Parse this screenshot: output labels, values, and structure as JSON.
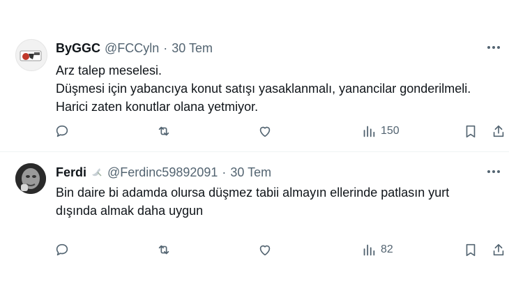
{
  "tweets": [
    {
      "author_name": "ByGGC",
      "handle": "@FCCyln",
      "separator": "·",
      "date": "30 Tem",
      "text": "Arz talep meselesi.\nDüşmesi için yabancıya konut satışı yasaklanmalı, yanancilar gonderilmeli.\nHarici zaten konutlar olana yetmiyor.",
      "views": "150"
    },
    {
      "author_name": "Ferdi",
      "handle": "@Ferdinc59892091",
      "separator": "·",
      "date": "30 Tem",
      "text": "Bin daire bi adamda olursa düşmez tabii almayın ellerinde patlasın yurt\ndışında almak daha uygun",
      "views": "82"
    }
  ],
  "icons": {
    "more": "more-horizontal-icon",
    "reply": "reply-icon",
    "retweet": "retweet-icon",
    "like": "heart-icon",
    "views": "analytics-icon",
    "bookmark": "bookmark-icon",
    "share": "share-icon"
  },
  "colors": {
    "text": "#0f1419",
    "secondary": "#536471",
    "divider": "#eff3f4"
  }
}
